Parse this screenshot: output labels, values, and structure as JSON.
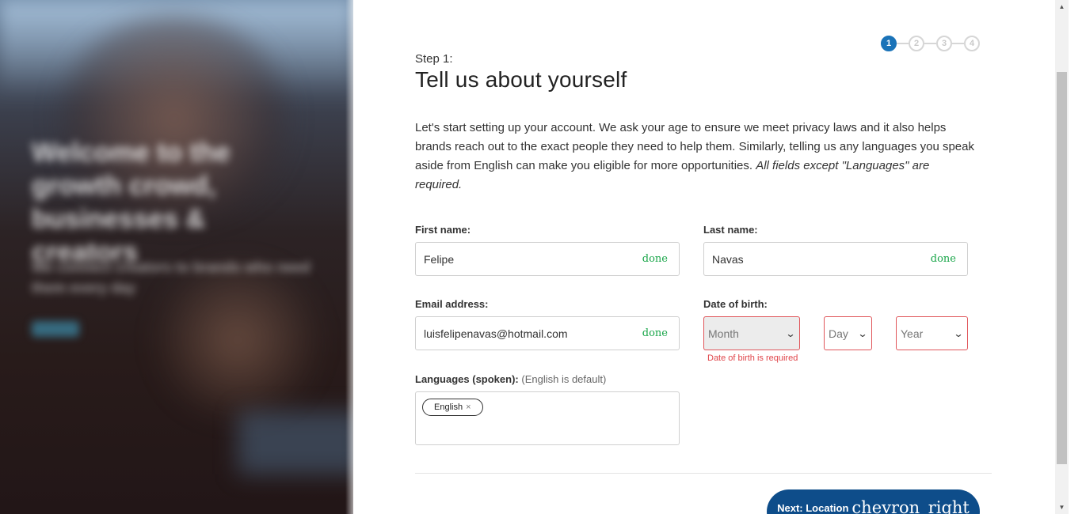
{
  "hero": {
    "headline": "Welcome to the growth crowd, businesses & creators",
    "subtext": "We connect creators to brands who need them every day"
  },
  "stepper": {
    "steps": [
      "1",
      "2",
      "3",
      "4"
    ],
    "active": 1
  },
  "step_label": "Step 1:",
  "title": "Tell us about yourself",
  "intro": {
    "text": "Let's start setting up your account. We ask your age to ensure we meet privacy laws and it also helps brands reach out to the exact people they need to help them. Similarly, telling us any languages you speak aside from English can make you eligible for more opportunities. ",
    "emphasis": "All fields except \"Languages\" are required."
  },
  "first_name": {
    "label": "First name:",
    "value": "Felipe",
    "status": "done"
  },
  "last_name": {
    "label": "Last name:",
    "value": "Navas",
    "status": "done"
  },
  "email": {
    "label": "Email address:",
    "value": "luisfelipenavas@hotmail.com",
    "status": "done"
  },
  "dob": {
    "label": "Date of birth:",
    "month_placeholder": "Month",
    "day_placeholder": "Day",
    "year_placeholder": "Year",
    "error": "Date of birth is required"
  },
  "languages": {
    "label": "Languages (spoken):",
    "hint": "(English is default)",
    "chips": [
      {
        "label": "English",
        "remove": "×"
      }
    ]
  },
  "next_button": {
    "label": "Next: Location",
    "icon_text": "chevron_right"
  },
  "colors": {
    "accent": "#1a73b8",
    "button": "#0e4d8a",
    "done": "#1aa64a",
    "error": "#e0454a"
  }
}
